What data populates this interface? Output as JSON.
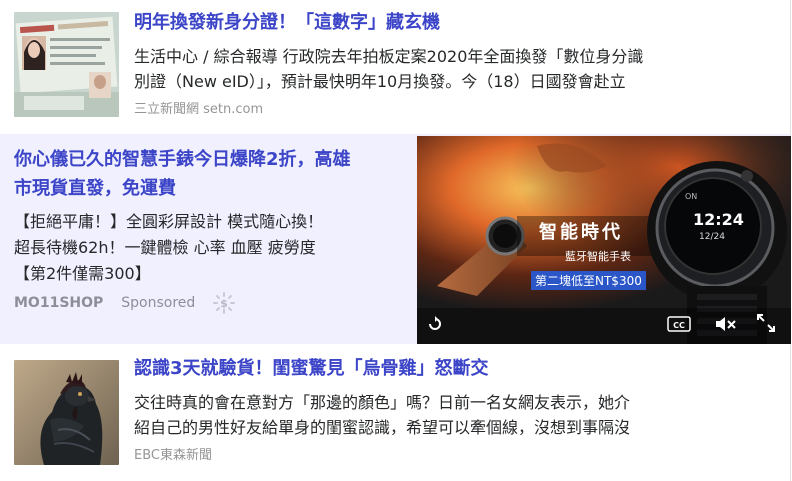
{
  "items": [
    {
      "title": "明年換發新身分證！「這數字」藏玄機",
      "summary_line1": "生活中心 / 綜合報導 行政院去年拍板定案2020年全面換發「數位身分識",
      "summary_line2": "別證（New eID）」，預計最快明年10月換發。今（18）日國發會赴立",
      "source": "三立新聞網 setn.com"
    },
    {
      "title": "認識3天就驗貨！閨蜜驚見「烏骨雞」怒斷交",
      "summary_line1": "交往時真的會在意對方「那邊的顏色」嗎？日前一名女網友表示，她介",
      "summary_line2": "紹自己的男性好友給單身的閨蜜認識，希望可以牽個線，沒想到事隔沒",
      "source": "EBC東森新聞"
    }
  ],
  "ad": {
    "title_line1": "你心儀已久的智慧手錶今日爆降2折，高雄",
    "title_line2": "市現貨直發，免運費",
    "desc_line1": "【拒絕平庸！】全圓彩屏設計 模式隨心換！",
    "desc_line2": "超長待機62h！一鍵體檢 心率 血壓 疲勞度",
    "desc_line3": "【第2件僅需300】",
    "brand": "MO11SHOP",
    "sponsored": "Sponsored",
    "video": {
      "headline": "智能時代",
      "subhead": "藍牙智能手表",
      "price_tag": "第二塊低至NT$300",
      "watch_time": "12:24",
      "watch_date": "12/24",
      "watch_text": "ON"
    }
  },
  "icons": {
    "replay": "replay-icon",
    "cc": "cc-icon",
    "mute": "mute-icon",
    "fullscreen": "fullscreen-icon",
    "ad_choice": "ad-choice-icon"
  },
  "colors": {
    "title": "#3c45c8",
    "ad_background": "#f0f0ff",
    "source": "#959595"
  }
}
